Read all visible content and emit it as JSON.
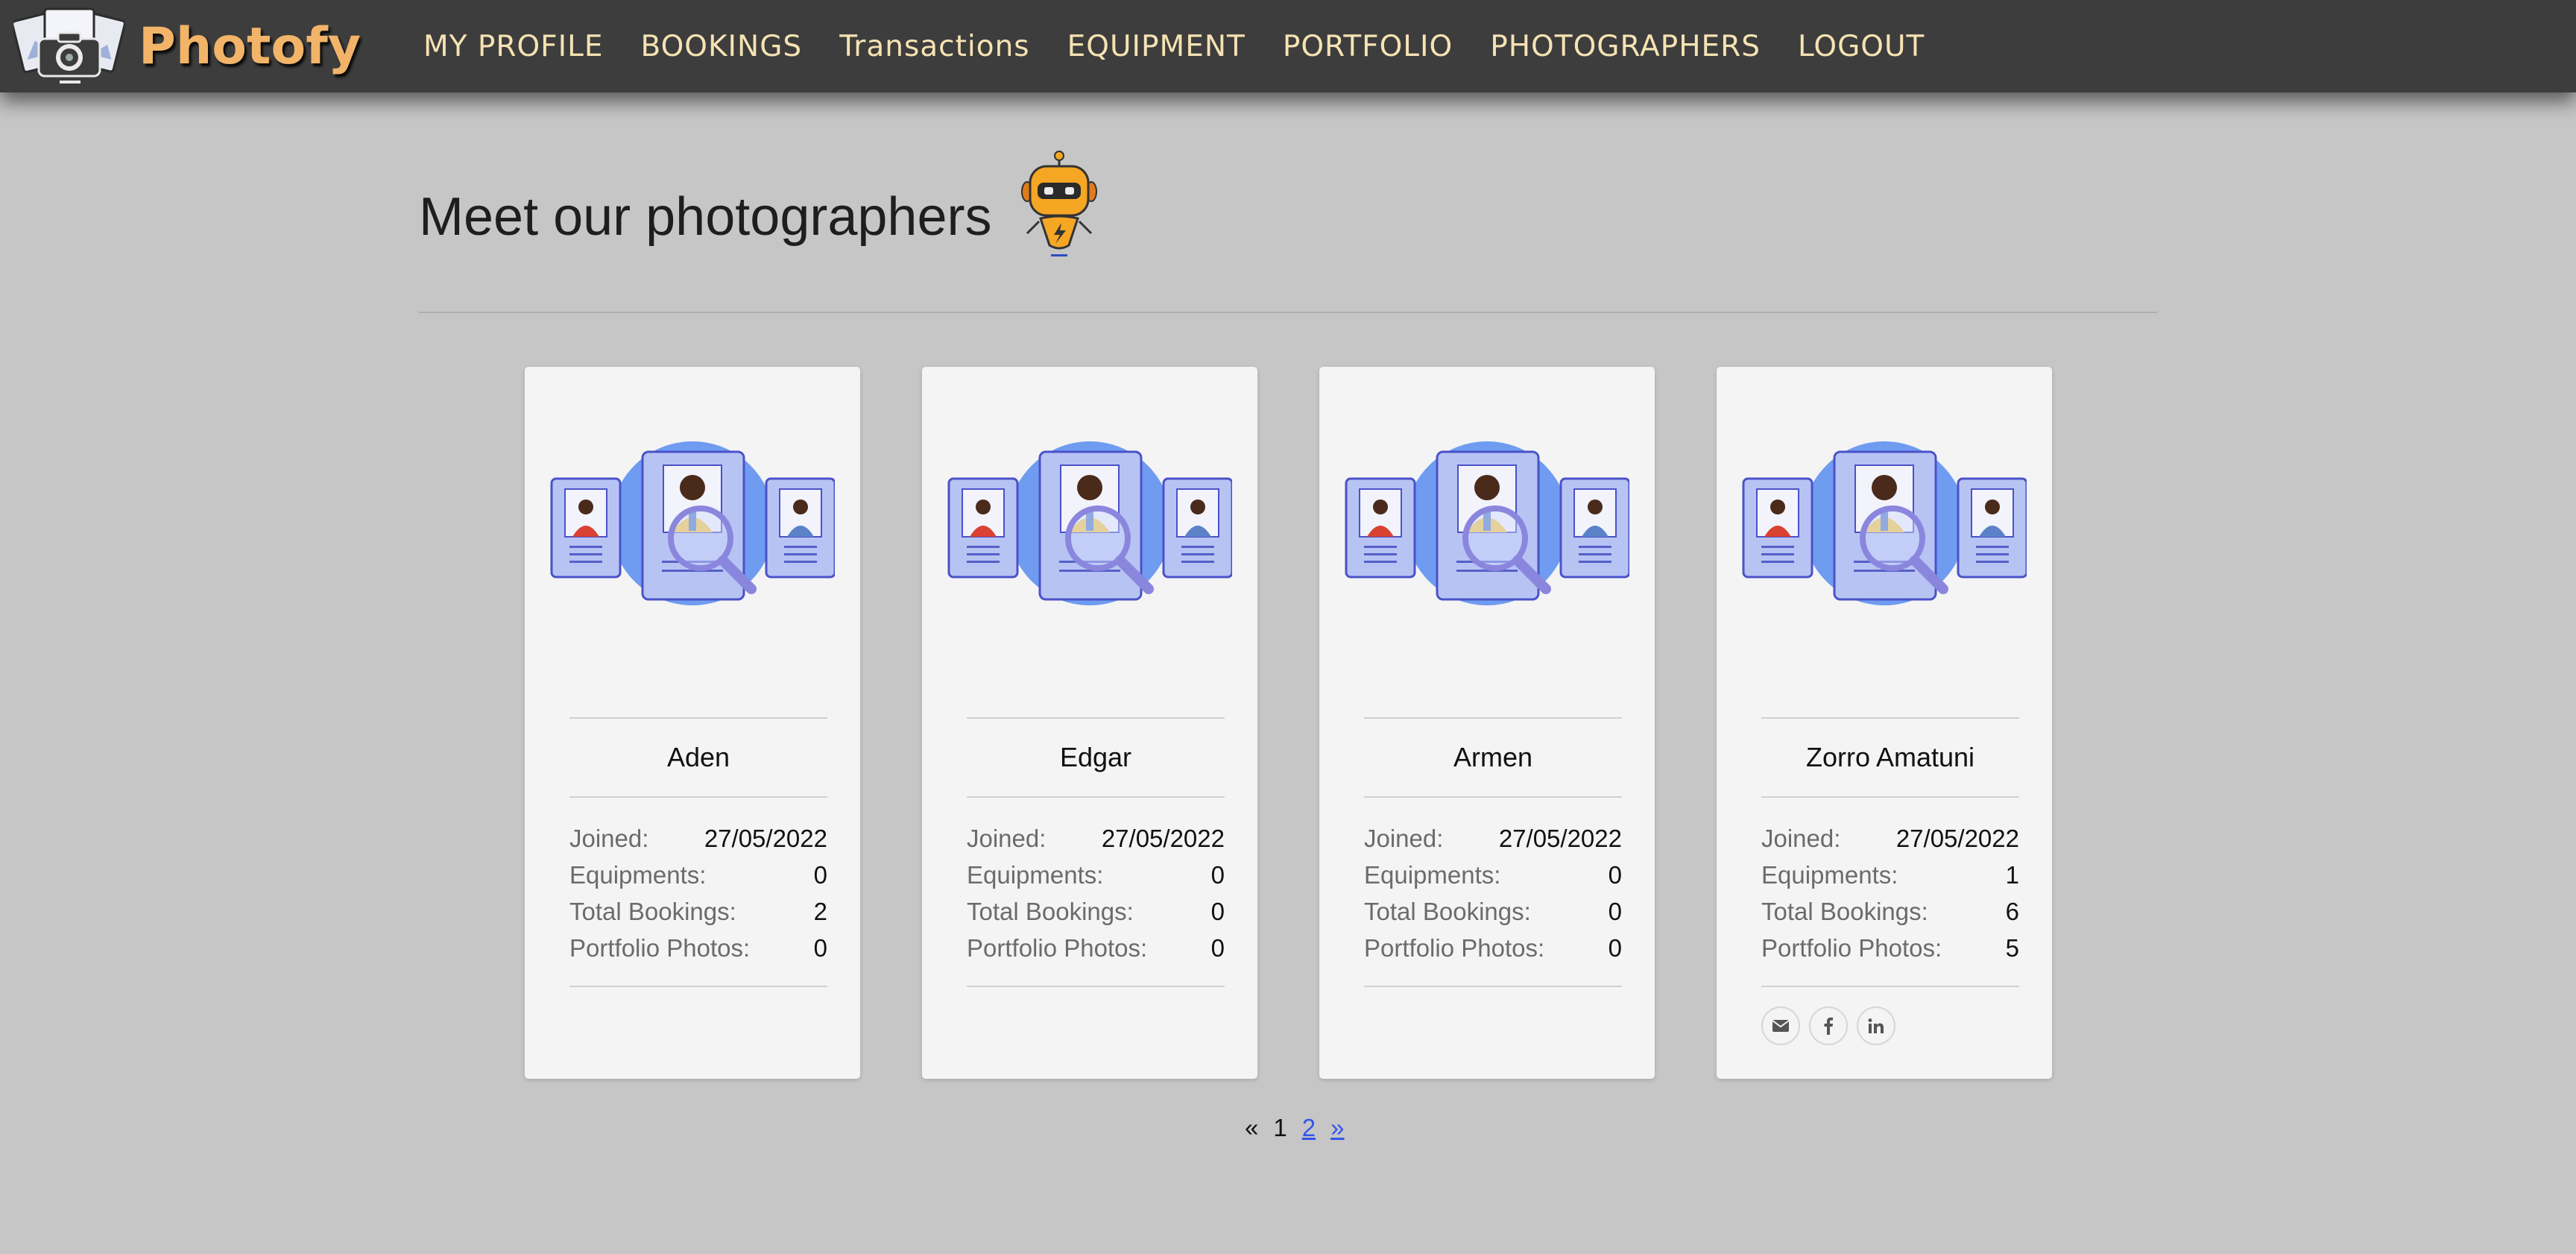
{
  "brand": {
    "name": "Photofy"
  },
  "nav": {
    "items": [
      {
        "label": "MY PROFILE"
      },
      {
        "label": "BOOKINGS"
      },
      {
        "label": "Transactions"
      },
      {
        "label": "EQUIPMENT"
      },
      {
        "label": "PORTFOLIO"
      },
      {
        "label": "PHOTOGRAPHERS"
      },
      {
        "label": "LOGOUT"
      }
    ]
  },
  "page": {
    "title": "Meet our photographers"
  },
  "labels": {
    "joined": "Joined:",
    "equipments": "Equipments:",
    "total_bookings": "Total Bookings:",
    "portfolio_photos": "Portfolio Photos:"
  },
  "photographers": [
    {
      "name": "Aden",
      "joined": "27/05/2022",
      "equipments": "0",
      "total_bookings": "2",
      "portfolio_photos": "0"
    },
    {
      "name": "Edgar",
      "joined": "27/05/2022",
      "equipments": "0",
      "total_bookings": "0",
      "portfolio_photos": "0"
    },
    {
      "name": "Armen",
      "joined": "27/05/2022",
      "equipments": "0",
      "total_bookings": "0",
      "portfolio_photos": "0"
    },
    {
      "name": "Zorro Amatuni",
      "joined": "27/05/2022",
      "equipments": "1",
      "total_bookings": "6",
      "portfolio_photos": "5",
      "socials": [
        "email-icon",
        "facebook-icon",
        "linkedin-icon"
      ]
    }
  ],
  "pagination": {
    "prev": "«",
    "current": "1",
    "next_page": "2",
    "next": "»"
  },
  "colors": {
    "navbar": "#3d3d3d",
    "brand": "#f2b469",
    "nav_text": "#f6e3b3",
    "background": "#c6c6c6",
    "card": "#f4f4f4",
    "link": "#3355ee"
  }
}
